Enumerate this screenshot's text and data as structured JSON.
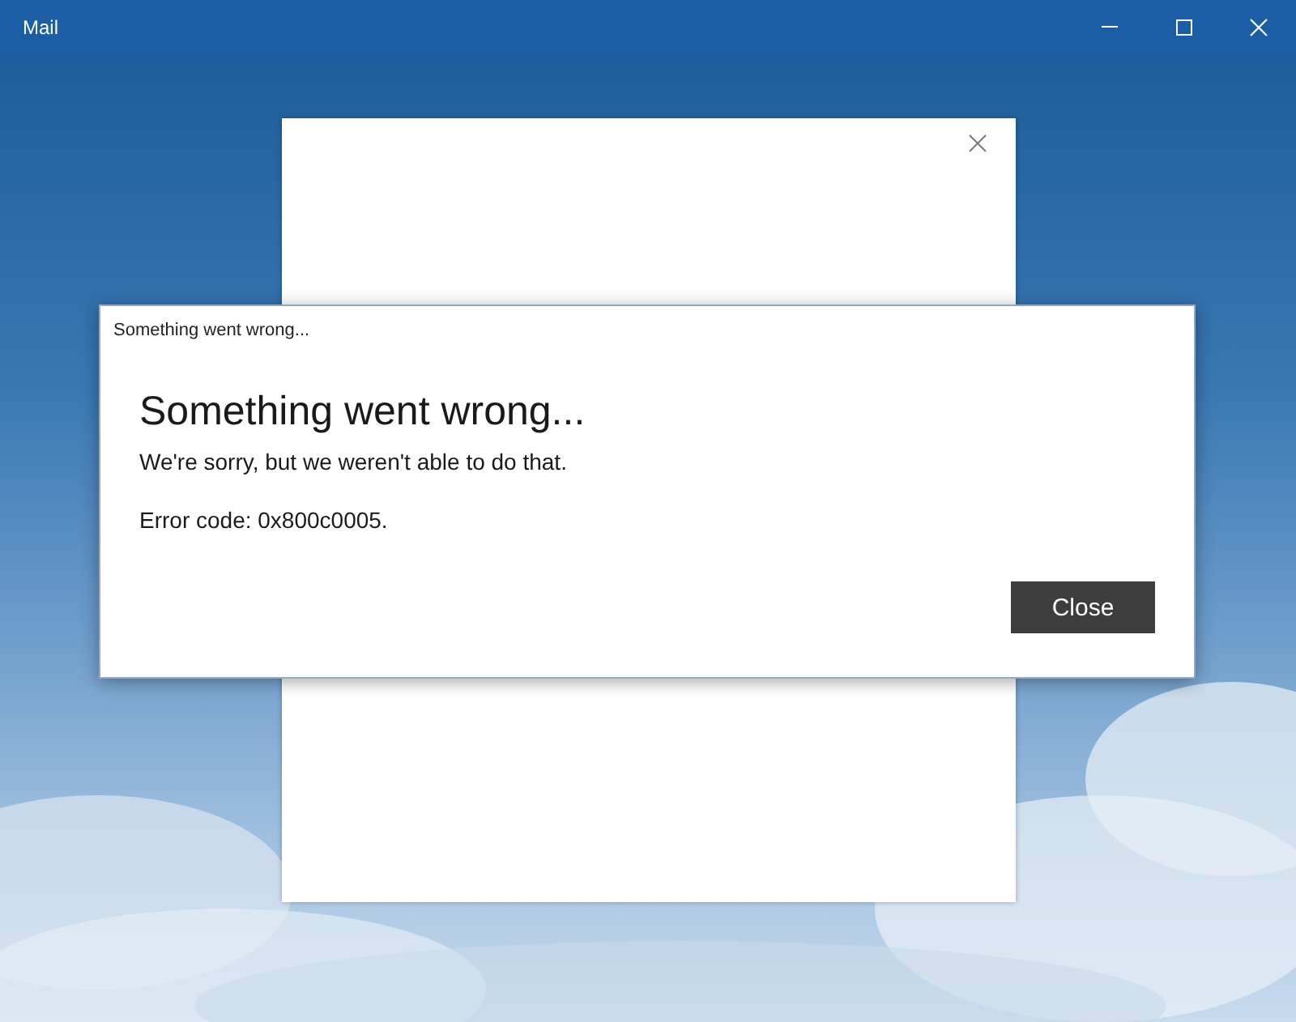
{
  "window": {
    "title": "Mail"
  },
  "dialog": {
    "caption": "Something went wrong...",
    "heading": "Something went wrong...",
    "message": "We're sorry, but we weren't able to do that.",
    "error_code": "Error code: 0x800c0005.",
    "buttons": [
      "Close"
    ]
  }
}
